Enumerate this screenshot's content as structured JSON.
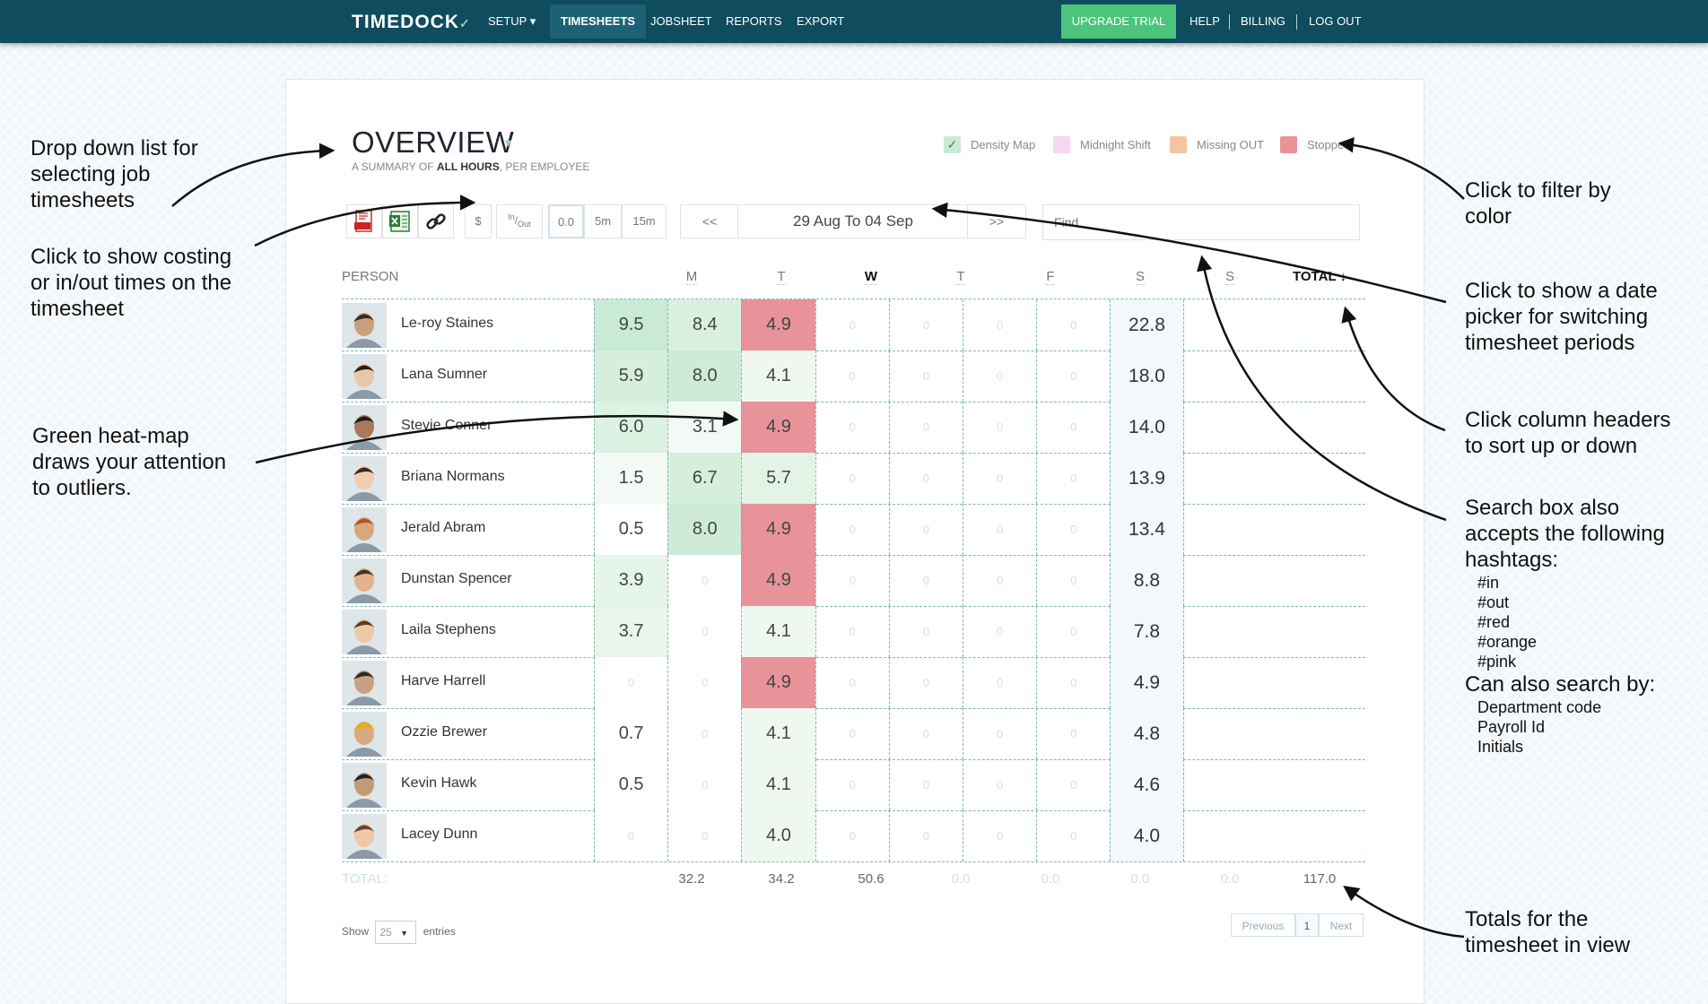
{
  "nav": {
    "logo": "TIMEDOCK",
    "items": [
      {
        "label": "SETUP ▾"
      },
      {
        "label": "TIMESHEETS"
      },
      {
        "label": "JOBSHEET"
      },
      {
        "label": "REPORTS"
      },
      {
        "label": "EXPORT"
      }
    ],
    "upgrade": "UPGRADE TRIAL",
    "right": [
      {
        "label": "HELP"
      },
      {
        "label": "BILLING"
      },
      {
        "label": "LOG OUT"
      }
    ]
  },
  "header": {
    "title": "OVERVIEW",
    "subtitle_pre": "A SUMMARY OF ",
    "subtitle_bold": "ALL HOURS",
    "subtitle_post": ", PER EMPLOYEE"
  },
  "legend": [
    {
      "label": "Density Map",
      "color": "#c9ead4",
      "check": "✓"
    },
    {
      "label": "Midnight Shift",
      "color": "#f6d8f3"
    },
    {
      "label": "Missing OUT",
      "color": "#f5c5a3"
    },
    {
      "label": "Stopped",
      "color": "#e8939a"
    }
  ],
  "toolbar": {
    "dollar": "$",
    "inout_in": "In",
    "inout_out": "Out",
    "round_options": [
      "0.0",
      "5m",
      "15m"
    ],
    "prev": "<<",
    "next": ">>",
    "date_range": "29 Aug To 04 Sep",
    "search_placeholder": "Find"
  },
  "table": {
    "headers": {
      "person": "PERSON",
      "days": [
        "M",
        "T",
        "W",
        "T",
        "F",
        "S",
        "S"
      ],
      "total": "TOTAL ↓"
    },
    "rows": [
      {
        "name": "Le-roy Staines",
        "days": [
          "9.5",
          "8.4",
          "4.9",
          "0",
          "0",
          "0",
          "0"
        ],
        "total": "22.8"
      },
      {
        "name": "Lana Sumner",
        "days": [
          "5.9",
          "8.0",
          "4.1",
          "0",
          "0",
          "0",
          "0"
        ],
        "total": "18.0"
      },
      {
        "name": "Stevie Conner",
        "days": [
          "6.0",
          "3.1",
          "4.9",
          "0",
          "0",
          "0",
          "0"
        ],
        "total": "14.0"
      },
      {
        "name": "Briana Normans",
        "days": [
          "1.5",
          "6.7",
          "5.7",
          "0",
          "0",
          "0",
          "0"
        ],
        "total": "13.9"
      },
      {
        "name": "Jerald Abram",
        "days": [
          "0.5",
          "8.0",
          "4.9",
          "0",
          "0",
          "0",
          "0"
        ],
        "total": "13.4"
      },
      {
        "name": "Dunstan Spencer",
        "days": [
          "3.9",
          "0",
          "4.9",
          "0",
          "0",
          "0",
          "0"
        ],
        "total": "8.8"
      },
      {
        "name": "Laila Stephens",
        "days": [
          "3.7",
          "0",
          "4.1",
          "0",
          "0",
          "0",
          "0"
        ],
        "total": "7.8"
      },
      {
        "name": "Harve Harrell",
        "days": [
          "0",
          "0",
          "4.9",
          "0",
          "0",
          "0",
          "0"
        ],
        "total": "4.9"
      },
      {
        "name": "Ozzie Brewer",
        "days": [
          "0.7",
          "0",
          "4.1",
          "0",
          "0",
          "0",
          "0"
        ],
        "total": "4.8"
      },
      {
        "name": "Kevin Hawk",
        "days": [
          "0.5",
          "0",
          "4.1",
          "0",
          "0",
          "0",
          "0"
        ],
        "total": "4.6"
      },
      {
        "name": "Lacey Dunn",
        "days": [
          "0",
          "0",
          "4.0",
          "0",
          "0",
          "0",
          "0"
        ],
        "total": "4.0"
      }
    ],
    "cell_colors": [
      [
        "#c9ead4",
        "#d9f0df",
        "#e8939a"
      ],
      [
        "#d6efdd",
        "#cdebd6",
        "#eef8f1"
      ],
      [
        "#dcf2e2",
        "#f3faf5",
        "#e8939a"
      ],
      [
        "#f3faf5",
        "#d6efdd",
        "#e3f4e7"
      ],
      [
        "#ffffff",
        "#cdebd6",
        "#e8939a"
      ],
      [
        "#e5f5ea",
        "#ffffff",
        "#e8939a"
      ],
      [
        "#e8f6ec",
        "#ffffff",
        "#eef8f1"
      ],
      [
        "#ffffff",
        "#ffffff",
        "#e8939a"
      ],
      [
        "#ffffff",
        "#ffffff",
        "#eef8f1"
      ],
      [
        "#ffffff",
        "#ffffff",
        "#eef8f1"
      ],
      [
        "#ffffff",
        "#ffffff",
        "#eef8f1"
      ]
    ],
    "totals_label": "TOTAL:",
    "totals": [
      "32.2",
      "34.2",
      "50.6",
      "0.0",
      "0.0",
      "0.0",
      "0.0"
    ],
    "grand_total": "117.0"
  },
  "footer": {
    "show": "Show",
    "entries_value": "25",
    "entries": "entries",
    "previous": "Previous",
    "page": "1",
    "next": "Next"
  },
  "annotations": {
    "dropdown": [
      "Drop down list for",
      "selecting job",
      "timesheets"
    ],
    "costing": [
      "Click to show costing",
      "or in/out times on the",
      "timesheet"
    ],
    "heatmap": [
      "Green heat-map",
      "draws your attention",
      "to outliers."
    ],
    "filter": [
      "Click to filter by",
      "color"
    ],
    "datepicker": [
      "Click to show a date",
      "picker for switching",
      "timesheet periods"
    ],
    "sort": [
      "Click column headers",
      "to sort up or down"
    ],
    "search": [
      "Search box also",
      "accepts the following",
      "hashtags:"
    ],
    "hashtags": [
      "#in",
      "#out",
      "#red",
      "#orange",
      "#pink"
    ],
    "search_by": "Can also search by:",
    "search_fields": [
      "Department code",
      "Payroll Id",
      "Initials"
    ],
    "totals": [
      "Totals for the",
      "timesheet in view"
    ]
  }
}
